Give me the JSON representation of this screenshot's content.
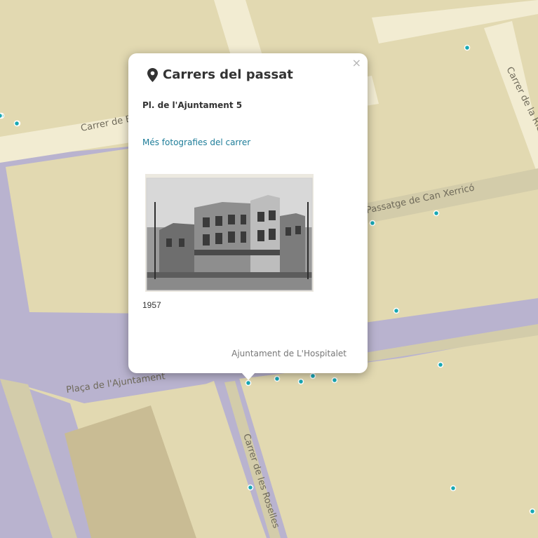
{
  "map": {
    "streets": {
      "carrer_de_bel": "Carrer de Be",
      "carrer_riera": "Carrer de la Riera de",
      "passatge_can_xerrico": "Passatge de Can Xerricó",
      "placa_ajuntament": "Plaça de l'Ajuntament",
      "carrer_roselles": "Carrer de les Roselles"
    },
    "marker_icon": "camera-marker-icon",
    "marker_color": "#18a8b4",
    "marker_count": 17
  },
  "popup": {
    "title": "Carrers del passat",
    "title_icon": "map-pin-icon",
    "close_label": "×",
    "address": "Pl. de l'Ajuntament 5",
    "link_label": "Més fotografies del carrer",
    "photo_year": "1957",
    "credit": "Ajuntament de L'Hospitalet",
    "link_color": "#1e7d99"
  }
}
